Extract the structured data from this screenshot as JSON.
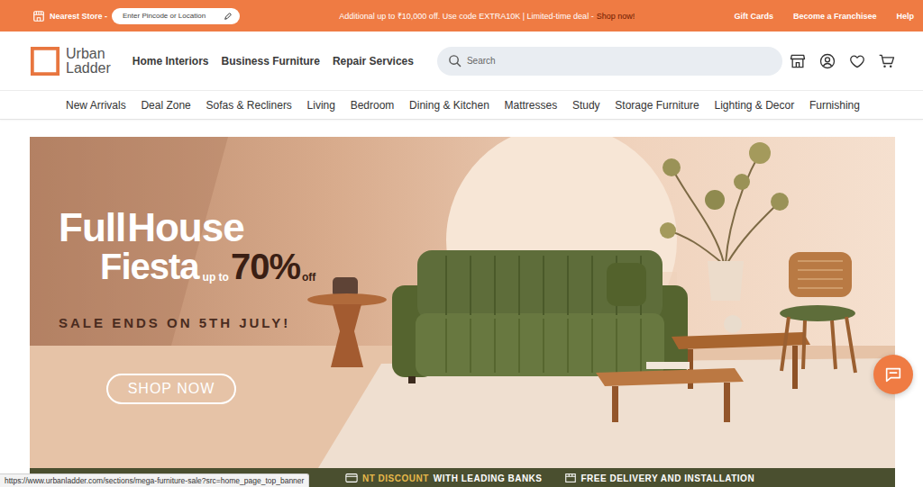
{
  "top_bar": {
    "store_label": "Nearest Store -",
    "pincode_placeholder": "Enter Pincode or Location",
    "promo": "Additional up to ₹10,000 off. Use code EXTRA10K | Limited-time deal -",
    "promo_link": "Shop now!",
    "links": [
      "Gift Cards",
      "Become a Franchisee",
      "Help"
    ]
  },
  "header": {
    "logo": [
      "Urban",
      "Ladder"
    ],
    "nav": [
      "Home Interiors",
      "Business Furniture",
      "Repair Services"
    ],
    "search_placeholder": "Search"
  },
  "categories": [
    "New Arrivals",
    "Deal Zone",
    "Sofas & Recliners",
    "Living",
    "Bedroom",
    "Dining & Kitchen",
    "Mattresses",
    "Study",
    "Storage Furniture",
    "Lighting & Decor",
    "Furnishing"
  ],
  "banner": {
    "title": [
      "Full",
      "House"
    ],
    "subtitle": "Fiesta",
    "discount_prefix": "up to",
    "discount": "70%",
    "discount_suffix": "off",
    "sale_note": "SALE ENDS ON 5TH JULY!",
    "cta": "SHOP NOW"
  },
  "offer_strip": [
    {
      "kind": "bank",
      "highlight": "NT DISCOUNT",
      "text": "WITH LEADING BANKS"
    },
    {
      "kind": "delivery",
      "highlight": "",
      "text": "FREE DELIVERY AND INSTALLATION"
    }
  ],
  "status_url": "https://www.urbanladder.com/sections/mega-furniture-sale?src=home_page_top_banner"
}
